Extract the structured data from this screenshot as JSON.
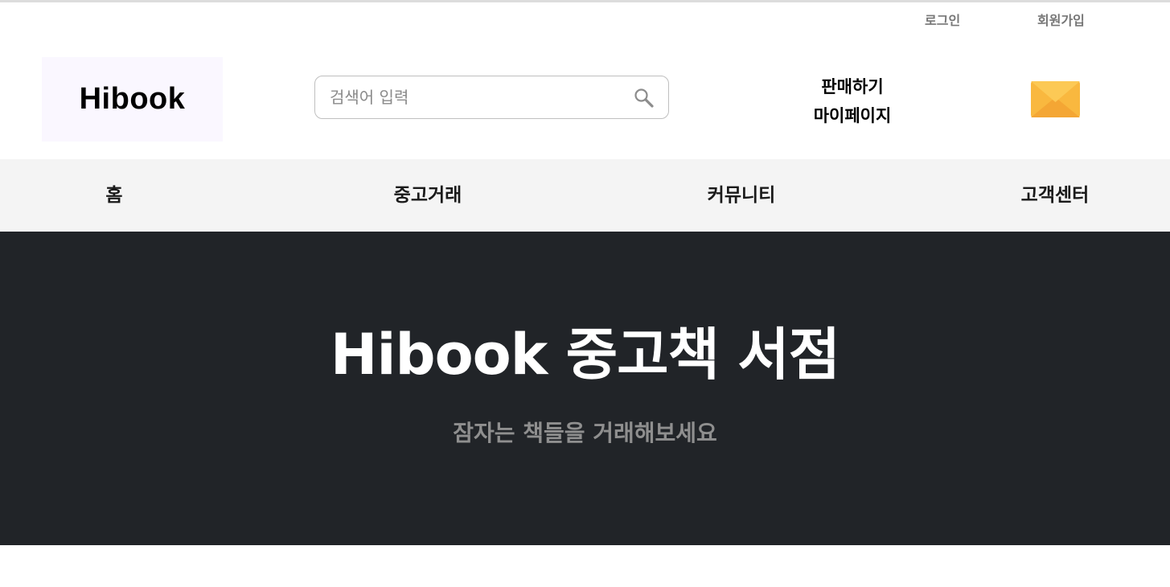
{
  "auth": {
    "login_label": "로그인",
    "signup_label": "회원가입"
  },
  "header": {
    "logo_text": "Hibook",
    "search": {
      "placeholder": "검색어 입력",
      "value": "",
      "icon": "search-icon"
    },
    "sell_label": "판매하기",
    "mypage_label": "마이페이지",
    "mail_icon": "mail-icon"
  },
  "nav": {
    "items": [
      {
        "label": "홈"
      },
      {
        "label": "중고거래"
      },
      {
        "label": "커뮤니티"
      },
      {
        "label": "고객센터"
      }
    ]
  },
  "hero": {
    "title": "Hibook 중고책 서점",
    "subtitle": "잠자는 책들을 거래해보세요"
  },
  "colors": {
    "nav_background": "#f4f4f4",
    "hero_background": "#212428",
    "hero_title": "#ffffff",
    "hero_subtitle": "#8f8f8f",
    "logo_background": "#faf7ff",
    "mail_icon": "#f7b43d"
  }
}
